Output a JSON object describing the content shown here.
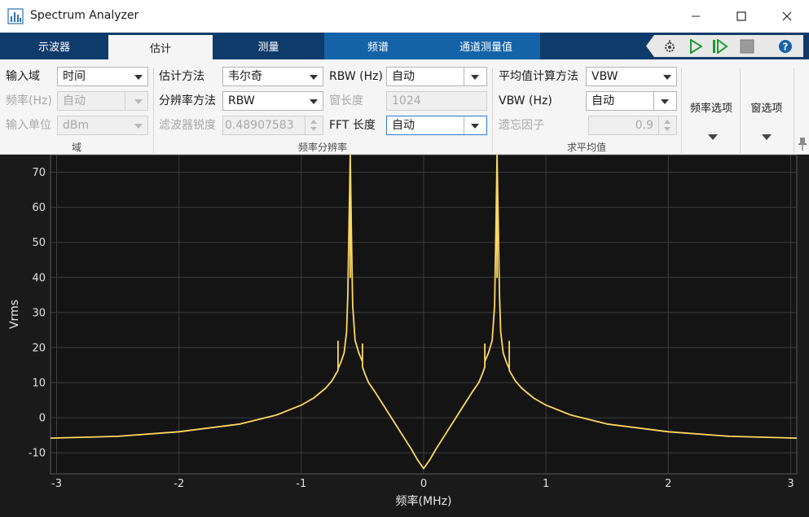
{
  "window": {
    "title": "Spectrum Analyzer",
    "app_icon": "bar-chart-icon"
  },
  "tabs": {
    "scope": "示波器",
    "estimate": "估计",
    "measure": "测量",
    "spectrum": "频谱",
    "channel": "通道测量值"
  },
  "domain_section": {
    "title": "域",
    "input_domain_label": "输入域",
    "input_domain_value": "时间",
    "sample_rate_label": "频率(Hz)",
    "sample_rate_value": "自动",
    "input_unit_label": "输入单位",
    "input_unit_value": "dBm"
  },
  "resolution_section": {
    "title": "频率分辨率",
    "method_label": "估计方法",
    "method_value": "韦尔奇",
    "res_method_label": "分辨率方法",
    "res_method_value": "RBW",
    "filter_sharp_label": "滤波器锐度",
    "filter_sharp_value": "0.48907583",
    "rbw_label": "RBW (Hz)",
    "rbw_value": "自动",
    "window_len_label": "窗长度",
    "window_len_value": "1024",
    "fft_len_label": "FFT 长度",
    "fft_len_value": "自动"
  },
  "averaging_section": {
    "title": "求平均值",
    "avg_method_label": "平均值计算方法",
    "avg_method_value": "VBW",
    "vbw_label": "VBW (Hz)",
    "vbw_value": "自动",
    "forget_label": "遗忘因子",
    "forget_value": "0.9"
  },
  "options": {
    "freq_options": "频率选项",
    "window_options": "窗选项"
  },
  "chart_data": {
    "type": "line",
    "xlabel": "频率(MHz)",
    "ylabel": "Vrms",
    "xlim": [
      -3.05,
      3.05
    ],
    "ylim": [
      -16,
      75
    ],
    "xticks": [
      -3,
      -2,
      -1,
      0,
      1,
      2,
      3
    ],
    "yticks": [
      -10,
      0,
      10,
      20,
      30,
      40,
      50,
      60,
      70
    ],
    "grid": true,
    "line_color": "#ffd862",
    "background": "#141414",
    "series": [
      {
        "x": [
          -3.05,
          -2.5,
          -2.0,
          -1.5,
          -1.2,
          -1.0,
          -0.9,
          -0.8,
          -0.75,
          -0.7,
          -0.7,
          -0.7,
          -0.68,
          -0.65,
          -0.63,
          -0.62,
          -0.61,
          -0.6,
          -0.6,
          -0.6,
          -0.59,
          -0.58,
          -0.56,
          -0.53,
          -0.5,
          -0.5,
          -0.5,
          -0.48,
          -0.45,
          -0.4,
          -0.3,
          -0.2,
          -0.1,
          -0.05,
          0.0,
          0.05,
          0.1,
          0.2,
          0.3,
          0.4,
          0.45,
          0.48,
          0.5,
          0.5,
          0.5,
          0.53,
          0.56,
          0.58,
          0.59,
          0.6,
          0.6,
          0.6,
          0.61,
          0.62,
          0.63,
          0.65,
          0.68,
          0.7,
          0.7,
          0.7,
          0.75,
          0.8,
          0.9,
          1.0,
          1.2,
          1.5,
          2.0,
          2.5,
          3.05
        ],
        "y": [
          -5.8,
          -5.3,
          -4.0,
          -1.8,
          0.8,
          3.6,
          5.6,
          8.5,
          10.5,
          13.5,
          21.8,
          14.0,
          15.5,
          18.5,
          24.5,
          35.0,
          55.0,
          75.0,
          40.0,
          75.0,
          52.0,
          32.0,
          22.0,
          18.5,
          16.0,
          21.0,
          14.5,
          12.5,
          10.0,
          7.5,
          2.0,
          -3.5,
          -9.0,
          -12.0,
          -14.5,
          -12.0,
          -9.0,
          -3.5,
          2.0,
          7.5,
          10.0,
          12.5,
          14.5,
          21.0,
          16.0,
          18.5,
          22.0,
          32.0,
          52.0,
          75.0,
          40.0,
          75.0,
          55.0,
          35.0,
          24.5,
          18.5,
          15.5,
          14.0,
          21.8,
          13.5,
          10.5,
          8.5,
          5.6,
          3.6,
          0.8,
          -1.8,
          -4.0,
          -5.3,
          -5.8
        ]
      }
    ]
  }
}
